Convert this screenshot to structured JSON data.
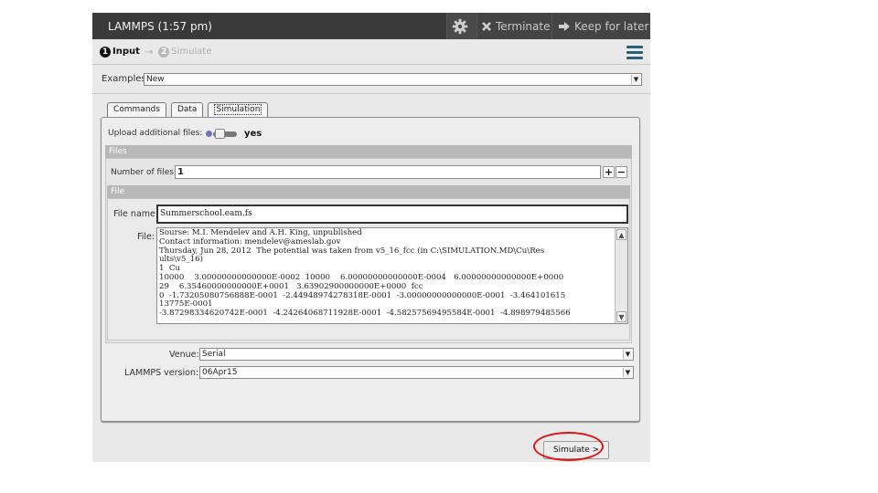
{
  "window": {
    "title": "LAMMPS (1:57 pm)",
    "terminate_label": "Terminate",
    "keep_label": "Keep for later"
  },
  "steps": [
    {
      "num": "1",
      "label": "Input"
    },
    {
      "num": "2",
      "label": "Simulate"
    }
  ],
  "examples": {
    "label": "Examples:",
    "value": "New"
  },
  "tabs": [
    {
      "label": "Commands"
    },
    {
      "label": "Data"
    },
    {
      "label": "Simulation"
    }
  ],
  "upload": {
    "label": "Upload additional files:",
    "toggle_value": "yes"
  },
  "files_section": {
    "header": "Files",
    "count_label": "Number of files:",
    "count_value": "1",
    "plus": "+",
    "minus": "−"
  },
  "file_section": {
    "header": "File",
    "name_label": "File name:",
    "name_value": "Summerschool.eam.fs",
    "content_label": "File:",
    "content_lines": [
      "Sourse: M.I. Mendelev and A.H. King, unpublished",
      "Contact information: mendelev@ameslab.gov",
      "Thursday, Jun 28, 2012  The potential was taken from v5_16_fcc (in C:\\SIMULATION.MD\\Cu\\Res",
      "ults\\v5_16)",
      "1  Cu",
      "10000    3.00000000000000E-0002  10000    6.00000000000000E-0004   6.00000000000000E+0000",
      "29    6.35460000000000E+0001   3.63902900000000E+0000  fcc",
      "0  -1.73205080756888E-0001  -2.44948974278318E-0001  -3.00000000000000E-0001  -3.464101615",
      "13775E-0001",
      "-3.87298334620742E-0001  -4.24264068711928E-0001  -4.58257569495584E-0001  -4.898979485566"
    ]
  },
  "venue": {
    "label": "Venue:",
    "value": "Serial"
  },
  "lammps_version": {
    "label": "LAMMPS version:",
    "value": "06Apr15"
  },
  "simulate_button": {
    "label": "Simulate >"
  },
  "colors": {
    "highlight_ring": "#e01616",
    "title_bar": "#3a3a3a",
    "menu_icon": "#2c5f7c"
  }
}
